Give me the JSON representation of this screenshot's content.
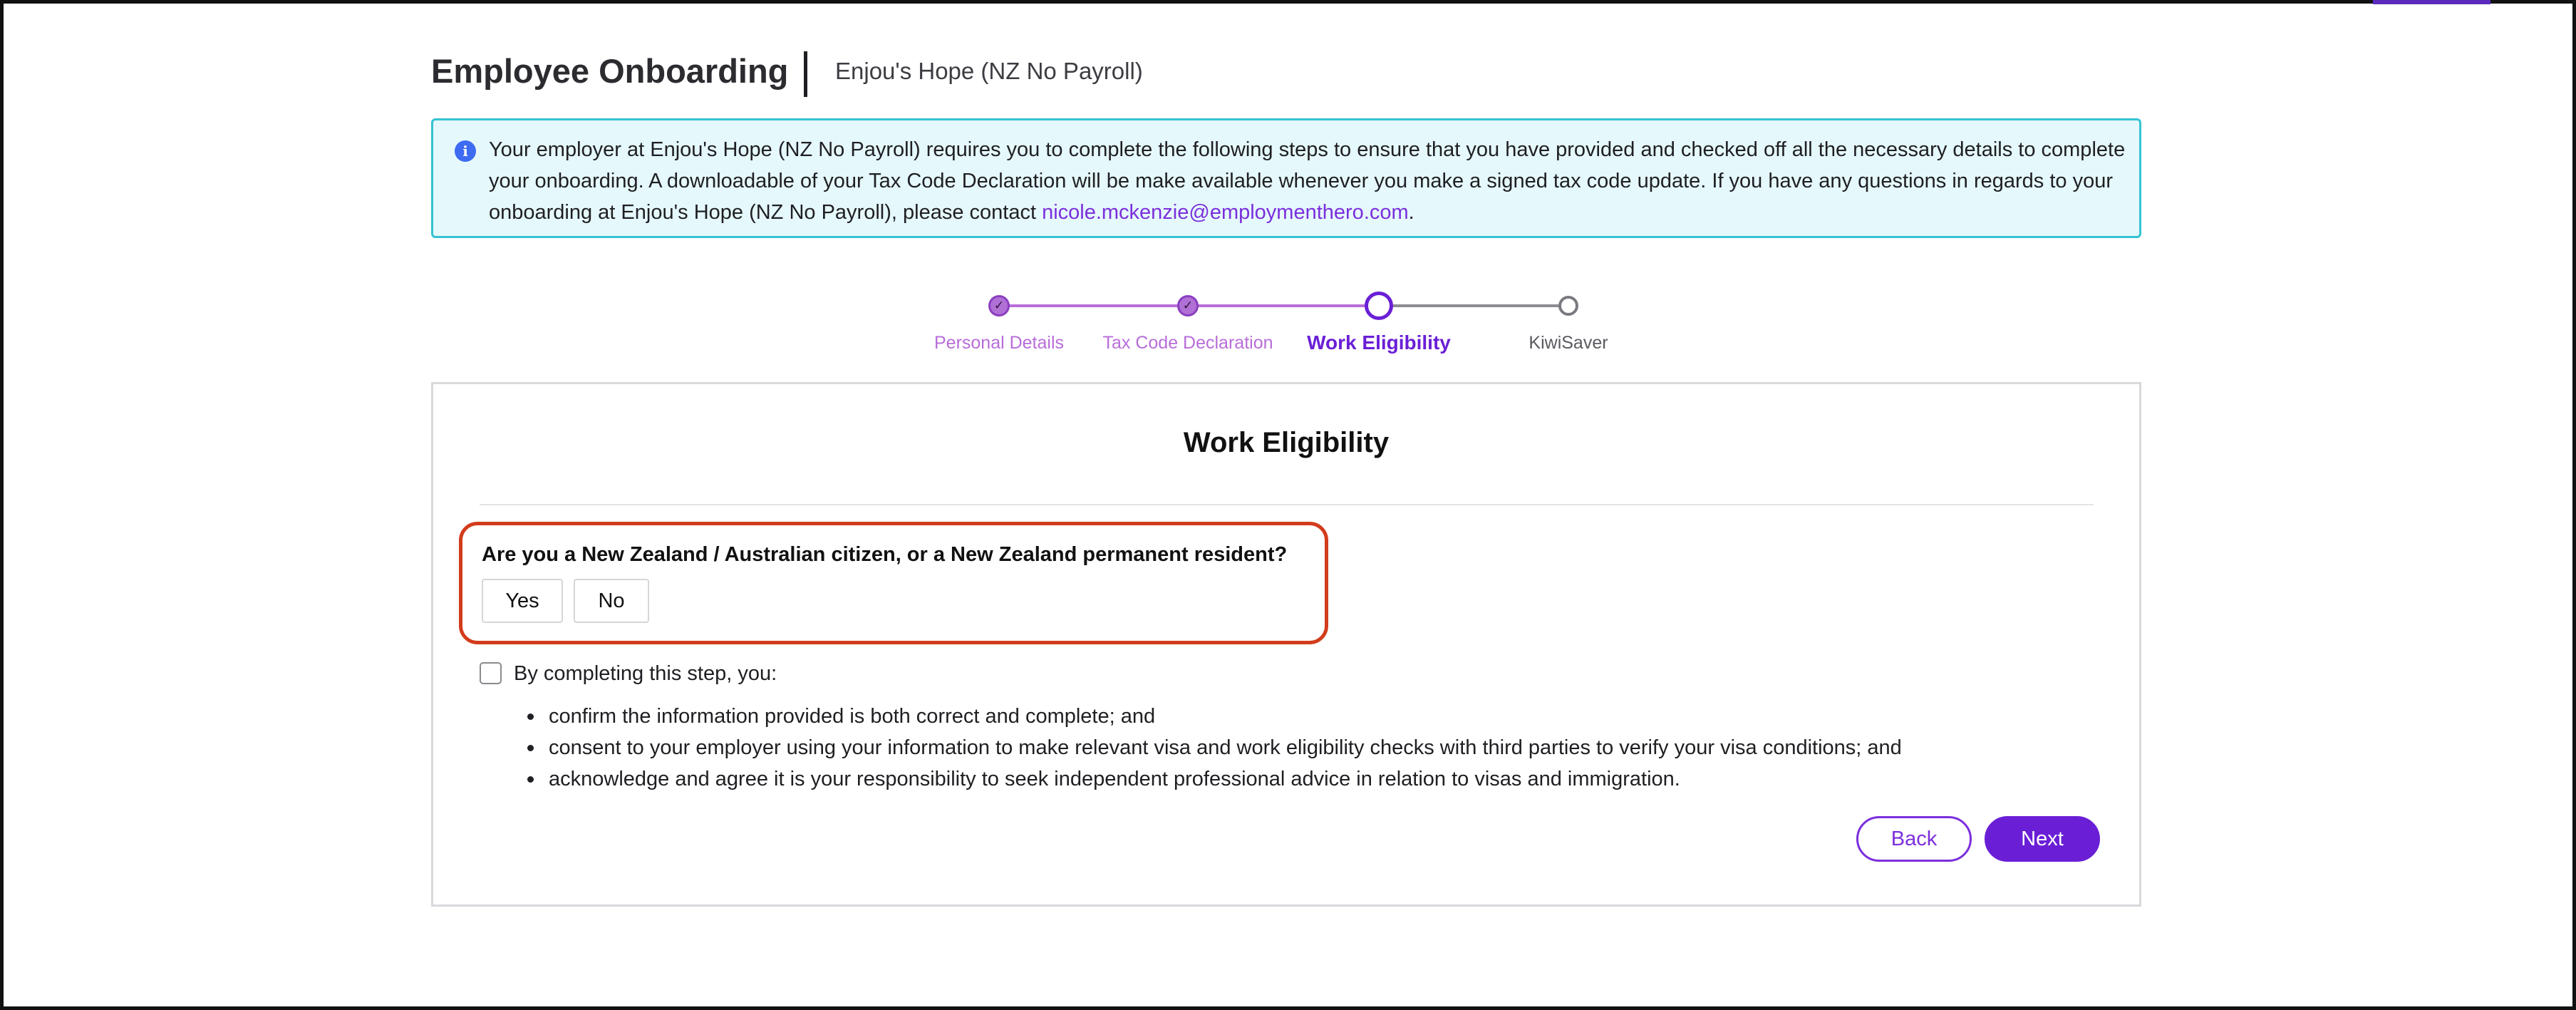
{
  "header": {
    "title": "Employee Onboarding",
    "company": "Enjou's Hope (NZ No Payroll)"
  },
  "info_banner": {
    "icon": "info-icon",
    "text": "Your employer at Enjou's Hope (NZ No Payroll) requires you to complete the following steps to ensure that you have provided and checked off all the necessary details to complete your onboarding. A downloadable of your Tax Code Declaration will be make available whenever you make a signed tax code update. If you have any questions in regards to your onboarding at Enjou's Hope (NZ No Payroll), please contact ",
    "email": "nicole.mckenzie@employmenthero.com",
    "suffix": "."
  },
  "stepper": {
    "steps": [
      {
        "label": "Personal Details",
        "status": "done"
      },
      {
        "label": "Tax Code Declaration",
        "status": "done"
      },
      {
        "label": "Work Eligibility",
        "status": "current"
      },
      {
        "label": "KiwiSaver",
        "status": "todo"
      }
    ],
    "done_icon": "check-icon",
    "colors": {
      "done_label": "#b86dd9",
      "current_label": "#6a1fd6",
      "todo_label": "#5a5a60",
      "done_line": "#b86dd9",
      "todo_line": "#8c8c92"
    }
  },
  "card": {
    "title": "Work Eligibility",
    "question": "Are you a New Zealand / Australian citizen, or a New Zealand permanent resident?",
    "answers": {
      "yes": "Yes",
      "no": "No"
    },
    "consent_label": "By completing this step, you:",
    "consent_items": [
      "confirm the information provided is both correct and complete; and",
      "consent to your employer using your information to make relevant visa and work eligibility checks with third parties to verify your visa conditions; and",
      "acknowledge and agree it is your responsibility to seek independent professional advice in relation to visas and immigration."
    ],
    "back_label": "Back",
    "next_label": "Next"
  },
  "colors": {
    "accent": "#6a1fd6",
    "highlight_border": "#d23c1c",
    "banner_bg": "#e5f8fb",
    "banner_border": "#35c3d4"
  }
}
